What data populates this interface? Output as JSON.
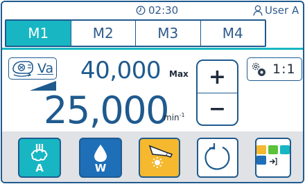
{
  "status": {
    "time": "02:30",
    "user": "User A",
    "clock_icon": "clock-icon",
    "user_icon": "user-icon"
  },
  "tabs": [
    {
      "label": "M1",
      "active": true
    },
    {
      "label": "M2",
      "active": false
    },
    {
      "label": "M3",
      "active": false
    },
    {
      "label": "M4",
      "active": false
    }
  ],
  "motor": {
    "mode_label": "Va",
    "icon": "handpiece-motor-icon"
  },
  "speed": {
    "max_value": "40,000",
    "max_label": "Max",
    "current_value": "25,000",
    "unit": "min",
    "unit_exp": "-1"
  },
  "controls": {
    "plus": "+",
    "minus": "−"
  },
  "ratio": {
    "label": "1:1",
    "icon": "gear-ratio-icon"
  },
  "bottom": {
    "air_label": "A",
    "water_label": "W"
  },
  "colors": {
    "accent": "#17b6c2",
    "border": "#1e5a8e",
    "water": "#1e6fb8",
    "light": "#f5b82e",
    "bar": "#e0e2e6"
  }
}
